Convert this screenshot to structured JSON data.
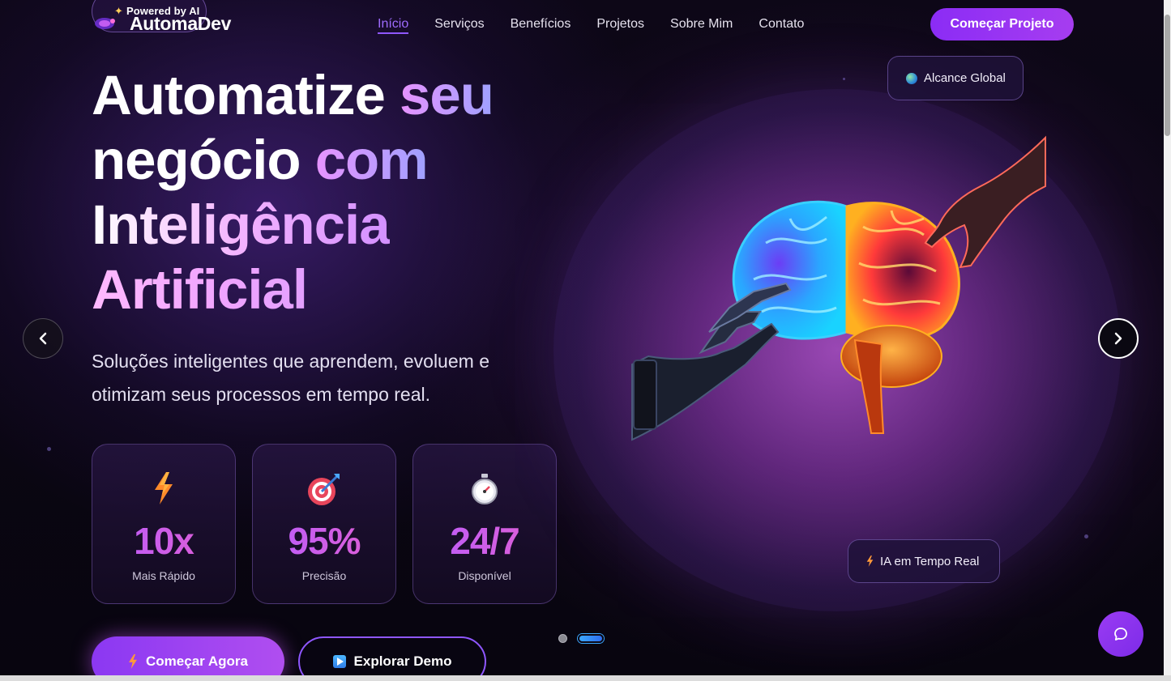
{
  "header": {
    "logo_tag": "Powered by AI",
    "logo_name": "AutomaDev",
    "nav": [
      "Início",
      "Serviços",
      "Benefícios",
      "Projetos",
      "Sobre Mim",
      "Contato"
    ],
    "active_nav": "Início",
    "cta": "Começar Projeto"
  },
  "hero": {
    "title": {
      "line1_a": "Automatize",
      "line1_b": "seu",
      "line2_a": "negócio",
      "line2_b": "com",
      "line3": "Inteligência",
      "line4": "Artificial"
    },
    "subtitle": "Soluções inteligentes que aprendem, evoluem e otimizam seus processos em tempo real.",
    "stats": [
      {
        "icon": "lightning-icon",
        "value": "10x",
        "label": "Mais Rápido"
      },
      {
        "icon": "target-icon",
        "value": "95%",
        "label": "Precisão"
      },
      {
        "icon": "stopwatch-icon",
        "value": "24/7",
        "label": "Disponível"
      }
    ],
    "primary_button": "Começar Agora",
    "secondary_button": "Explorar Demo"
  },
  "visual": {
    "badge_top": "Alcance Global",
    "badge_bottom": "IA em Tempo Real"
  },
  "carousel": {
    "slides": 2,
    "active_slide": 2
  },
  "colors": {
    "accent": "#8b2cf5",
    "accent_light": "#9f6cff",
    "background": "#07050d"
  }
}
